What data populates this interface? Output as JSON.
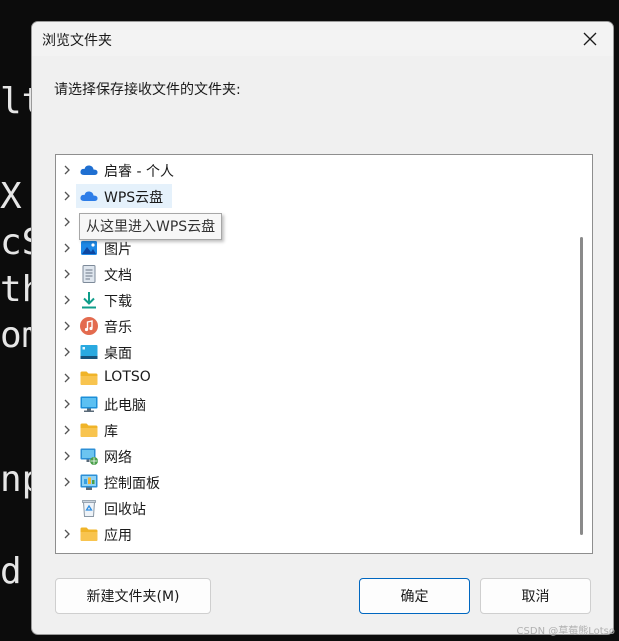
{
  "terminal": {
    "lines": [
      "lt",
      "X",
      "cS",
      "th",
      "om",
      "np",
      "d"
    ]
  },
  "dialog": {
    "title": "浏览文件夹",
    "prompt": "请选择保存接收文件的文件夹:",
    "tooltip": "从这里进入WPS云盘",
    "tree": [
      {
        "label": "启睿 - 个人",
        "icon": "onedrive-cloud-icon",
        "expandable": true
      },
      {
        "label": "WPS云盘",
        "icon": "wps-cloud-icon",
        "expandable": true,
        "hovered": true
      },
      {
        "label": "",
        "icon": "purple-folder-icon",
        "expandable": true
      },
      {
        "label": "图片",
        "icon": "pictures-icon",
        "expandable": true
      },
      {
        "label": "文档",
        "icon": "documents-icon",
        "expandable": true
      },
      {
        "label": "下载",
        "icon": "downloads-icon",
        "expandable": true
      },
      {
        "label": "音乐",
        "icon": "music-icon",
        "expandable": true
      },
      {
        "label": "桌面",
        "icon": "desktop-icon",
        "expandable": true
      },
      {
        "label": "LOTSO",
        "icon": "folder-icon",
        "expandable": true
      },
      {
        "label": "此电脑",
        "icon": "this-pc-icon",
        "expandable": true
      },
      {
        "label": "库",
        "icon": "library-folder-icon",
        "expandable": true
      },
      {
        "label": "网络",
        "icon": "network-icon",
        "expandable": true
      },
      {
        "label": "控制面板",
        "icon": "control-panel-icon",
        "expandable": true
      },
      {
        "label": "回收站",
        "icon": "recycle-bin-icon",
        "expandable": false
      },
      {
        "label": "应用",
        "icon": "apps-folder-icon",
        "expandable": true
      }
    ],
    "buttons": {
      "new_folder": "新建文件夹(M)",
      "ok": "确定",
      "cancel": "取消"
    }
  },
  "watermark": "CSDN @草莓熊Lotso",
  "colors": {
    "accent": "#0067c0",
    "hover": "#e5f1fb",
    "folder": "#f8c44f"
  }
}
